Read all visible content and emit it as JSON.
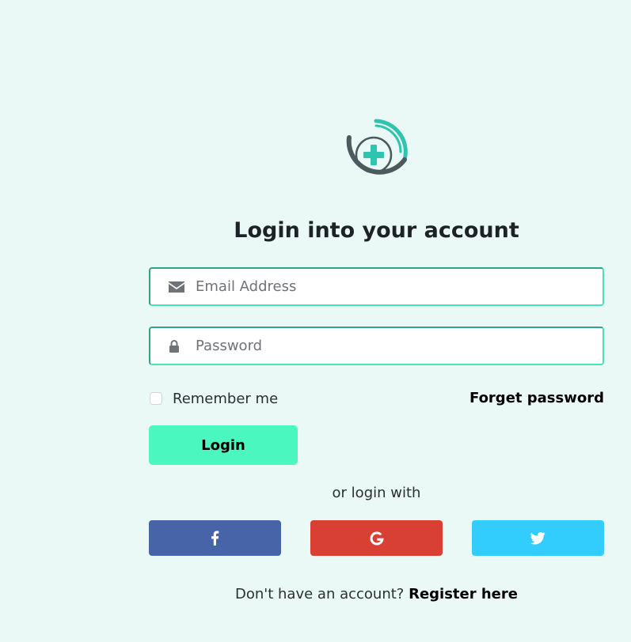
{
  "login": {
    "title": "Login into your account",
    "email": {
      "placeholder": "Email Address",
      "value": "",
      "icon": "envelope-icon"
    },
    "password": {
      "placeholder": "Password",
      "value": "",
      "icon": "lock-icon"
    },
    "remember_label": "Remember me",
    "remember_checked": false,
    "forget_label": "Forget password",
    "button_label": "Login",
    "or_text": "or login with",
    "social": [
      {
        "name": "facebook",
        "icon": "facebook-icon",
        "color": "#4764a8"
      },
      {
        "name": "google",
        "icon": "google-icon",
        "color": "#d94034"
      },
      {
        "name": "twitter",
        "icon": "twitter-icon",
        "color": "#32cdfd"
      }
    ],
    "register_prompt": "Don't have an account?",
    "register_link": "Register here"
  },
  "theme": {
    "background": "#eaf8f6",
    "accent": "#4af7bf",
    "logo_teal": "#2ec4b0",
    "logo_dark": "#4b5a5c"
  }
}
